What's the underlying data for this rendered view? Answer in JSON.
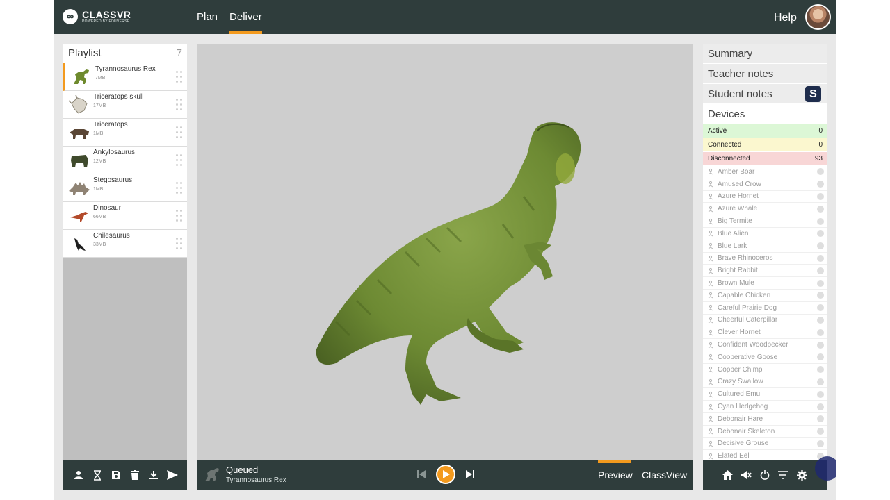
{
  "app": {
    "logo_brand": "CLASSVR",
    "logo_sub": "POWERED BY EDUVERSE"
  },
  "nav": {
    "plan": "Plan",
    "deliver": "Deliver",
    "help": "Help"
  },
  "playlist": {
    "title": "Playlist",
    "count": "7",
    "items": [
      {
        "name": "Tyrannosaurus Rex",
        "size": "7MB"
      },
      {
        "name": "Triceratops skull",
        "size": "17MB"
      },
      {
        "name": "Triceratops",
        "size": "1MB"
      },
      {
        "name": "Ankylosaurus",
        "size": "12MB"
      },
      {
        "name": "Stegosaurus",
        "size": "1MB"
      },
      {
        "name": "Dinosaur",
        "size": "66MB"
      },
      {
        "name": "Chilesaurus",
        "size": "33MB"
      }
    ],
    "toolbar_icons": [
      "user-icon",
      "hourglass-icon",
      "save-icon",
      "trash-icon",
      "download-icon",
      "send-icon"
    ]
  },
  "player": {
    "status": "Queued",
    "current": "Tyrannosaurus Rex",
    "tab_preview": "Preview",
    "tab_classview": "ClassView"
  },
  "panel": {
    "summary": "Summary",
    "teacher_notes": "Teacher notes",
    "student_notes": "Student notes",
    "devices": "Devices",
    "s_badge": "S",
    "status": {
      "active_label": "Active",
      "active_count": "0",
      "connected_label": "Connected",
      "connected_count": "0",
      "disconnected_label": "Disconnected",
      "disconnected_count": "93"
    },
    "devices_list": [
      "Amber Boar",
      "Amused Crow",
      "Azure Hornet",
      "Azure Whale",
      "Big Termite",
      "Blue Alien",
      "Blue Lark",
      "Brave Rhinoceros",
      "Bright Rabbit",
      "Brown Mule",
      "Capable Chicken",
      "Careful Prairie Dog",
      "Cheerful Caterpillar",
      "Clever Hornet",
      "Confident Woodpecker",
      "Cooperative Goose",
      "Copper Chimp",
      "Crazy Swallow",
      "Cultured Emu",
      "Cyan Hedgehog",
      "Debonair Hare",
      "Debonair Skeleton",
      "Decisive Grouse",
      "Elated Eel"
    ]
  },
  "colors": {
    "header_bg": "#2f3d3c",
    "accent": "#f39a1e",
    "active_bg": "#dcf7d6",
    "connected_bg": "#fbf7cf",
    "disconnected_bg": "#f8d6d6"
  }
}
